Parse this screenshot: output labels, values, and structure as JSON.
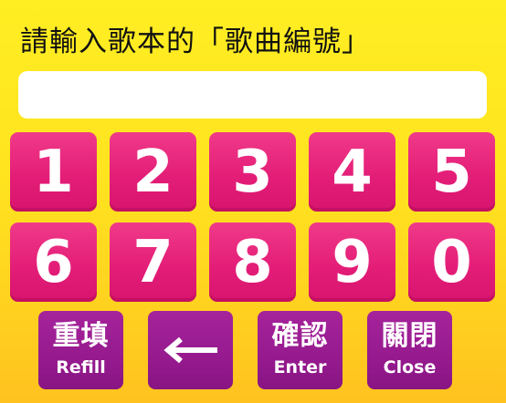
{
  "prompt": "請輸入歌本的「歌曲編號」",
  "song_number_input": {
    "value": "",
    "placeholder": ""
  },
  "keypad": {
    "keys": [
      "1",
      "2",
      "3",
      "4",
      "5",
      "6",
      "7",
      "8",
      "9",
      "0"
    ]
  },
  "actions": {
    "refill": {
      "zh": "重填",
      "en": "Refill"
    },
    "backspace": {
      "icon": "left-arrow-icon"
    },
    "confirm": {
      "zh": "確認",
      "en": "Enter"
    },
    "close": {
      "zh": "關閉",
      "en": "Close"
    }
  },
  "colors": {
    "background_top": "#ffee22",
    "background_bottom": "#ffc21f",
    "digit_key": "#e41e78",
    "action_key": "#961a8e",
    "text_light": "#ffffff"
  }
}
